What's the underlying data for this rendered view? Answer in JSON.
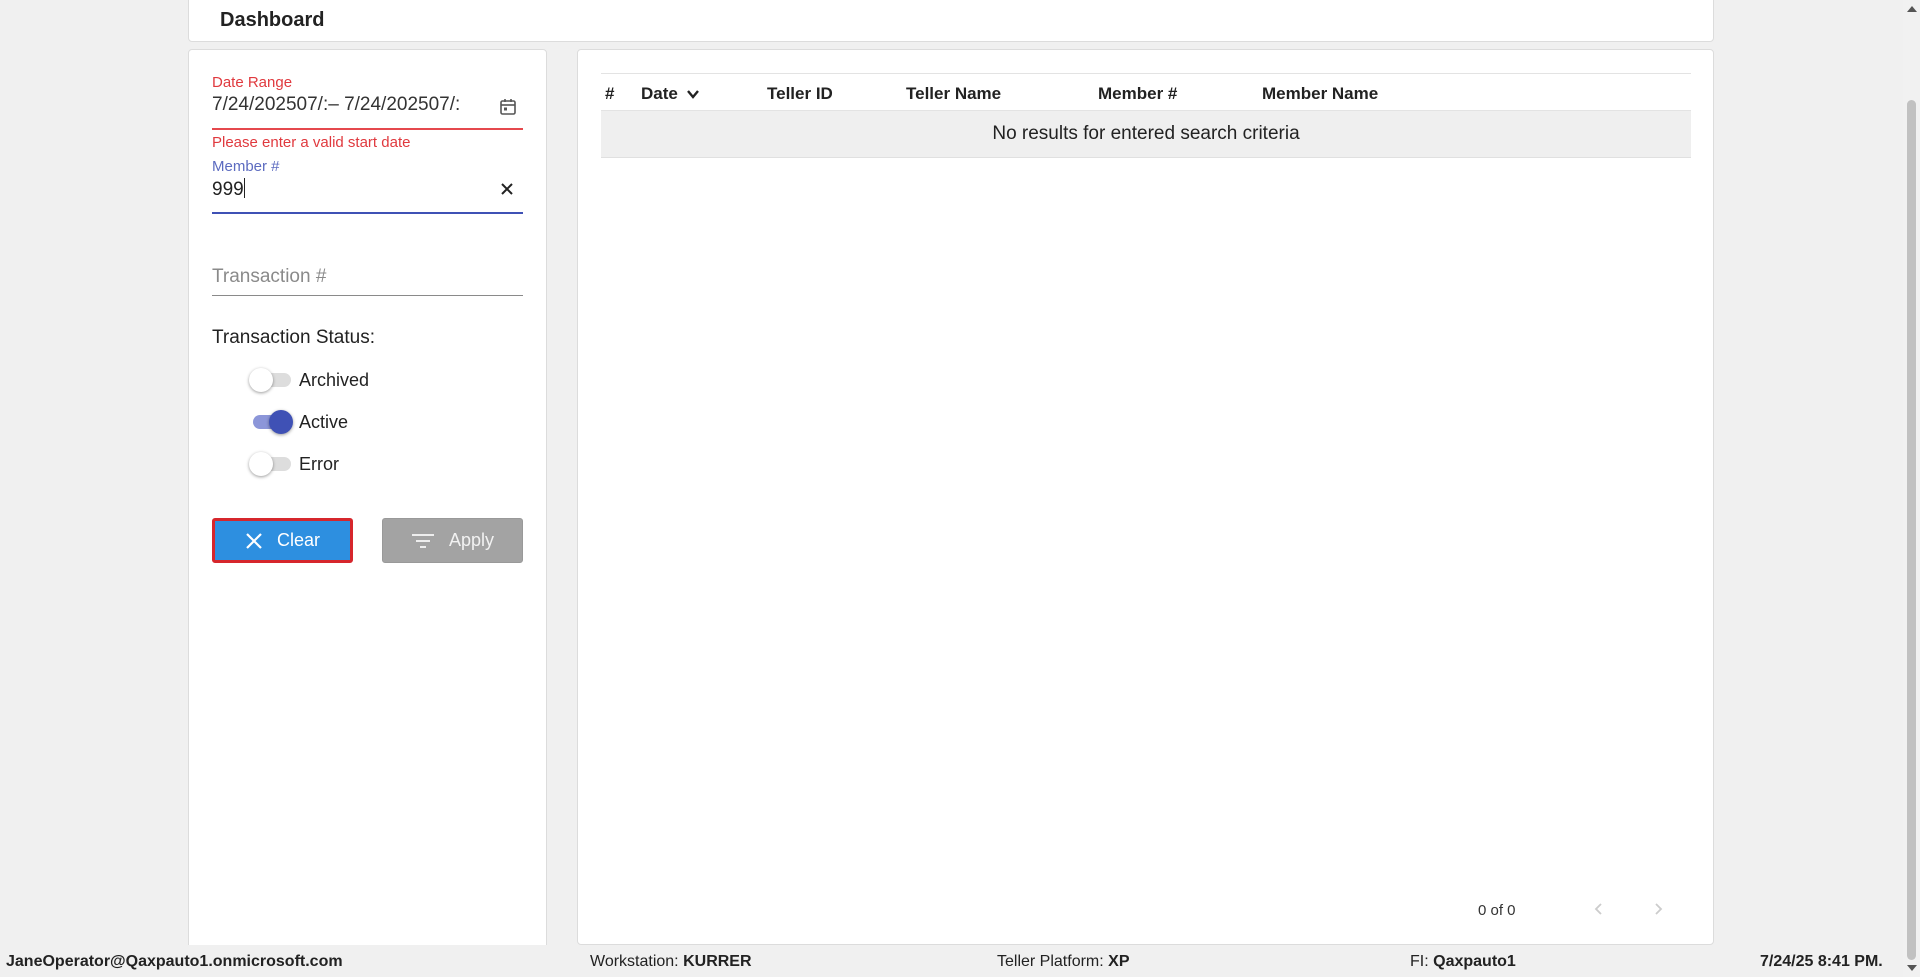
{
  "header": {
    "title": "Dashboard"
  },
  "filters": {
    "date_range": {
      "label": "Date Range",
      "value": "7/24/202507/:– 7/24/202507/:",
      "error": "Please enter a valid start date"
    },
    "member": {
      "label": "Member #",
      "value": "999"
    },
    "transaction": {
      "placeholder": "Transaction #"
    },
    "status_heading": "Transaction Status:",
    "statuses": [
      {
        "label": "Archived",
        "on": false
      },
      {
        "label": "Active",
        "on": true
      },
      {
        "label": "Error",
        "on": false
      }
    ],
    "clear_label": "Clear",
    "apply_label": "Apply"
  },
  "table": {
    "columns": [
      "#",
      "Date",
      "Teller ID",
      "Teller Name",
      "Member #",
      "Member Name"
    ],
    "empty_message": "No results for entered search criteria",
    "pager": "0 of 0"
  },
  "status_bar": {
    "user": "JaneOperator@Qaxpauto1.onmicrosoft.com",
    "workstation_label": "Workstation:",
    "workstation": "KURRER",
    "platform_label": "Teller Platform:",
    "platform": "XP",
    "fi_label": "FI:",
    "fi": "Qaxpauto1",
    "datetime": "7/24/25 8:41 PM."
  }
}
